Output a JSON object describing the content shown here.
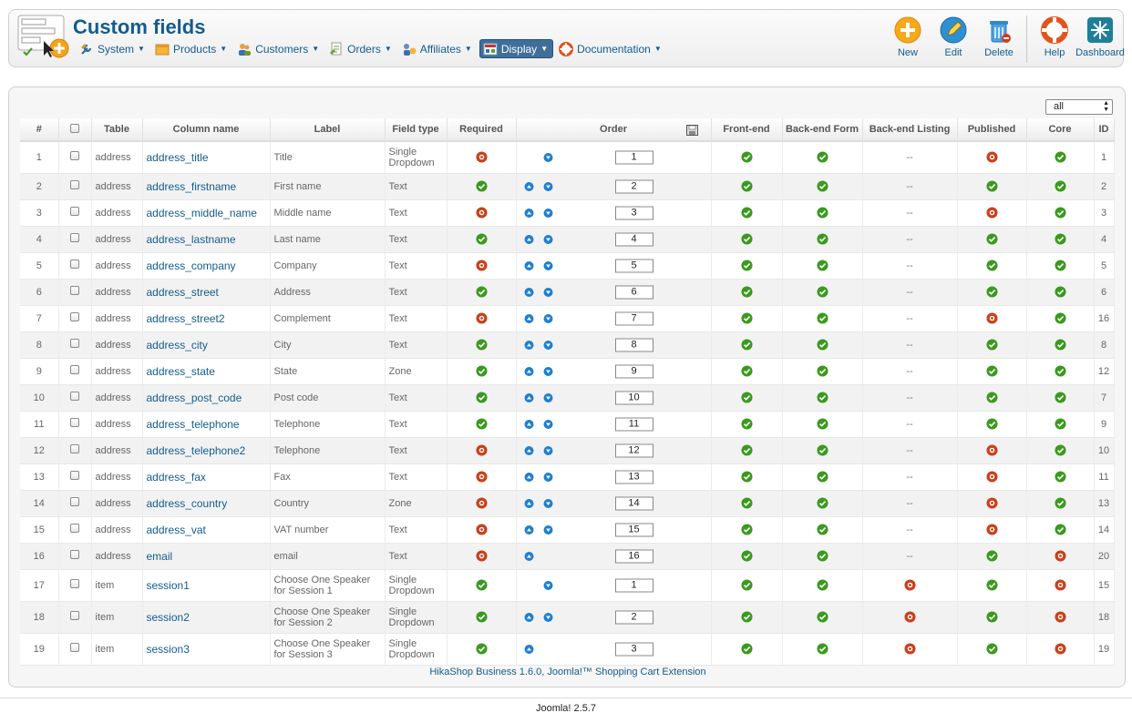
{
  "header": {
    "title": "Custom fields",
    "menu": [
      {
        "label": "System",
        "icon": "wrench-icon"
      },
      {
        "label": "Products",
        "icon": "box-icon"
      },
      {
        "label": "Customers",
        "icon": "users-icon"
      },
      {
        "label": "Orders",
        "icon": "orders-icon"
      },
      {
        "label": "Affiliates",
        "icon": "affiliate-icon"
      },
      {
        "label": "Display",
        "icon": "display-icon",
        "active": true
      },
      {
        "label": "Documentation",
        "icon": "lifebuoy-icon"
      }
    ],
    "toolbar": [
      {
        "label": "New",
        "icon": "plus-circle-icon"
      },
      {
        "label": "Edit",
        "icon": "pencil-icon"
      },
      {
        "label": "Delete",
        "icon": "trash-icon"
      },
      {
        "label": "Help",
        "icon": "lifebuoy-icon"
      },
      {
        "label": "Dashboard",
        "icon": "dashboard-icon"
      }
    ]
  },
  "filter": {
    "value": "all"
  },
  "table": {
    "headers": [
      "#",
      "",
      "Table",
      "Column name",
      "Label",
      "Field type",
      "Required",
      "Order",
      "Front-end",
      "Back-end Form",
      "Back-end Listing",
      "Published",
      "Core",
      "ID"
    ],
    "rows": [
      {
        "num": "1",
        "table": "address",
        "column": "address_title",
        "label": "Title",
        "type": "Single Dropdown",
        "required": false,
        "up": false,
        "down": true,
        "order": "1",
        "front": true,
        "backform": true,
        "listing": "--",
        "published": false,
        "core": true,
        "id": "1"
      },
      {
        "num": "2",
        "table": "address",
        "column": "address_firstname",
        "label": "First name",
        "type": "Text",
        "required": true,
        "up": true,
        "down": true,
        "order": "2",
        "front": true,
        "backform": true,
        "listing": "--",
        "published": true,
        "core": true,
        "id": "2"
      },
      {
        "num": "3",
        "table": "address",
        "column": "address_middle_name",
        "label": "Middle name",
        "type": "Text",
        "required": false,
        "up": true,
        "down": true,
        "order": "3",
        "front": true,
        "backform": true,
        "listing": "--",
        "published": false,
        "core": true,
        "id": "3"
      },
      {
        "num": "4",
        "table": "address",
        "column": "address_lastname",
        "label": "Last name",
        "type": "Text",
        "required": true,
        "up": true,
        "down": true,
        "order": "4",
        "front": true,
        "backform": true,
        "listing": "--",
        "published": true,
        "core": true,
        "id": "4"
      },
      {
        "num": "5",
        "table": "address",
        "column": "address_company",
        "label": "Company",
        "type": "Text",
        "required": false,
        "up": true,
        "down": true,
        "order": "5",
        "front": true,
        "backform": true,
        "listing": "--",
        "published": true,
        "core": true,
        "id": "5"
      },
      {
        "num": "6",
        "table": "address",
        "column": "address_street",
        "label": "Address",
        "type": "Text",
        "required": true,
        "up": true,
        "down": true,
        "order": "6",
        "front": true,
        "backform": true,
        "listing": "--",
        "published": true,
        "core": true,
        "id": "6"
      },
      {
        "num": "7",
        "table": "address",
        "column": "address_street2",
        "label": "Complement",
        "type": "Text",
        "required": false,
        "up": true,
        "down": true,
        "order": "7",
        "front": true,
        "backform": true,
        "listing": "--",
        "published": false,
        "core": true,
        "id": "16"
      },
      {
        "num": "8",
        "table": "address",
        "column": "address_city",
        "label": "City",
        "type": "Text",
        "required": true,
        "up": true,
        "down": true,
        "order": "8",
        "front": true,
        "backform": true,
        "listing": "--",
        "published": true,
        "core": true,
        "id": "8"
      },
      {
        "num": "9",
        "table": "address",
        "column": "address_state",
        "label": "State",
        "type": "Zone",
        "required": true,
        "up": true,
        "down": true,
        "order": "9",
        "front": true,
        "backform": true,
        "listing": "--",
        "published": true,
        "core": true,
        "id": "12"
      },
      {
        "num": "10",
        "table": "address",
        "column": "address_post_code",
        "label": "Post code",
        "type": "Text",
        "required": true,
        "up": true,
        "down": true,
        "order": "10",
        "front": true,
        "backform": true,
        "listing": "--",
        "published": true,
        "core": true,
        "id": "7"
      },
      {
        "num": "11",
        "table": "address",
        "column": "address_telephone",
        "label": "Telephone",
        "type": "Text",
        "required": true,
        "up": true,
        "down": true,
        "order": "11",
        "front": true,
        "backform": true,
        "listing": "--",
        "published": true,
        "core": true,
        "id": "9"
      },
      {
        "num": "12",
        "table": "address",
        "column": "address_telephone2",
        "label": "Telephone",
        "type": "Text",
        "required": false,
        "up": true,
        "down": true,
        "order": "12",
        "front": true,
        "backform": true,
        "listing": "--",
        "published": false,
        "core": true,
        "id": "10"
      },
      {
        "num": "13",
        "table": "address",
        "column": "address_fax",
        "label": "Fax",
        "type": "Text",
        "required": false,
        "up": true,
        "down": true,
        "order": "13",
        "front": true,
        "backform": true,
        "listing": "--",
        "published": false,
        "core": true,
        "id": "11"
      },
      {
        "num": "14",
        "table": "address",
        "column": "address_country",
        "label": "Country",
        "type": "Zone",
        "required": false,
        "up": true,
        "down": true,
        "order": "14",
        "front": true,
        "backform": true,
        "listing": "--",
        "published": false,
        "core": true,
        "id": "13"
      },
      {
        "num": "15",
        "table": "address",
        "column": "address_vat",
        "label": "VAT number",
        "type": "Text",
        "required": false,
        "up": true,
        "down": true,
        "order": "15",
        "front": true,
        "backform": true,
        "listing": "--",
        "published": false,
        "core": true,
        "id": "14"
      },
      {
        "num": "16",
        "table": "address",
        "column": "email",
        "label": "email",
        "type": "Text",
        "required": false,
        "up": true,
        "down": false,
        "order": "16",
        "front": true,
        "backform": true,
        "listing": "--",
        "published": true,
        "core": false,
        "id": "20"
      },
      {
        "num": "17",
        "table": "item",
        "column": "session1",
        "label": "Choose One Speaker for Session 1",
        "type": "Single Dropdown",
        "required": true,
        "up": false,
        "down": true,
        "order": "1",
        "front": true,
        "backform": true,
        "listing": false,
        "published": true,
        "core": false,
        "id": "15"
      },
      {
        "num": "18",
        "table": "item",
        "column": "session2",
        "label": "Choose One Speaker for Session 2",
        "type": "Single Dropdown",
        "required": true,
        "up": true,
        "down": true,
        "order": "2",
        "front": true,
        "backform": true,
        "listing": false,
        "published": true,
        "core": false,
        "id": "18"
      },
      {
        "num": "19",
        "table": "item",
        "column": "session3",
        "label": "Choose One Speaker for Session 3",
        "type": "Single Dropdown",
        "required": true,
        "up": true,
        "down": false,
        "order": "3",
        "front": true,
        "backform": true,
        "listing": false,
        "published": true,
        "core": false,
        "id": "19"
      }
    ]
  },
  "footer": {
    "extension": "HikaShop Business 1.6.0, Joomla!™ Shopping Cart Extension",
    "cms": "Joomla! 2.5.7"
  },
  "colors": {
    "accent": "#135c8e",
    "ok": "#3a9a1e",
    "no": "#c9401a",
    "arrow": "#1f7fd0"
  }
}
